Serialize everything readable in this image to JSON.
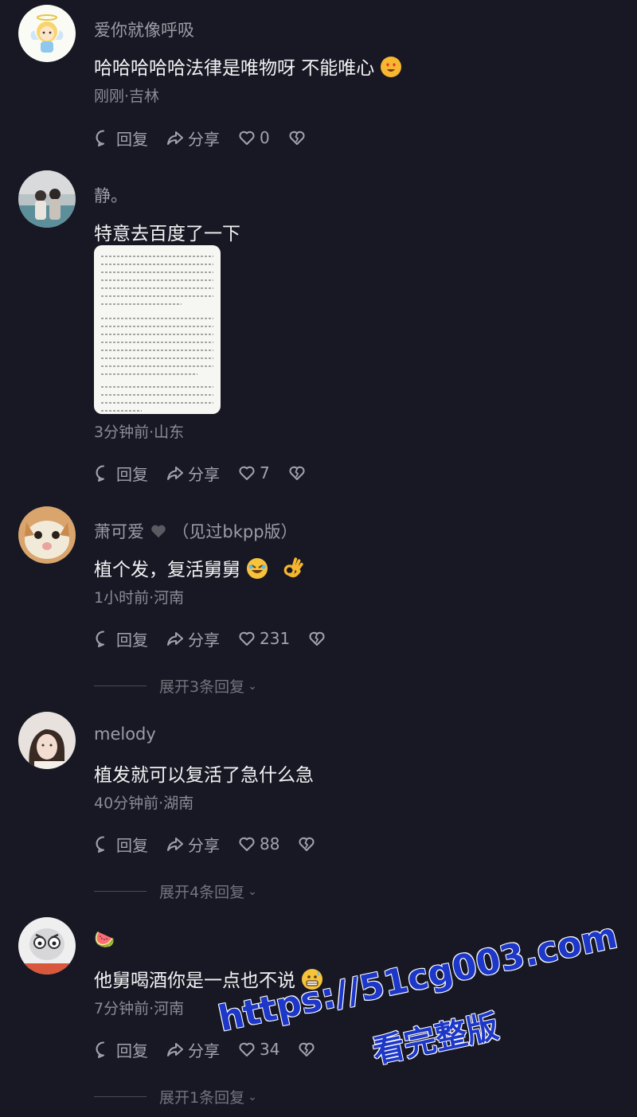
{
  "comments": [
    {
      "username": "爱你就像呼吸",
      "text": "哈哈哈哈哈法律是唯物呀 不能唯心",
      "meta": "刚刚·吉林",
      "reply_label": "回复",
      "share_label": "分享",
      "likes": "0"
    },
    {
      "username": "静。",
      "text": "特意去百度了一下",
      "meta": "3分钟前·山东",
      "reply_label": "回复",
      "share_label": "分享",
      "likes": "7"
    },
    {
      "username": "萧可爱",
      "username_suffix": "（见过bkpp版）",
      "text": "植个发，复活舅舅",
      "meta": "1小时前·河南",
      "reply_label": "回复",
      "share_label": "分享",
      "likes": "231",
      "expand_label": "展开3条回复"
    },
    {
      "username": "melody",
      "text": "植发就可以复活了急什么急",
      "meta": "40分钟前·湖南",
      "reply_label": "回复",
      "share_label": "分享",
      "likes": "88",
      "expand_label": "展开4条回复"
    },
    {
      "username": "🍉",
      "text": "他舅喝酒你是一点也不说",
      "meta": "7分钟前·河南",
      "reply_label": "回复",
      "share_label": "分享",
      "likes": "34",
      "expand_label": "展开1条回复"
    }
  ],
  "watermark": {
    "line1": "https://51cg003.com",
    "line2": "看完整版"
  },
  "colors": {
    "background": "#171823",
    "watermark": "#1d37c8"
  }
}
